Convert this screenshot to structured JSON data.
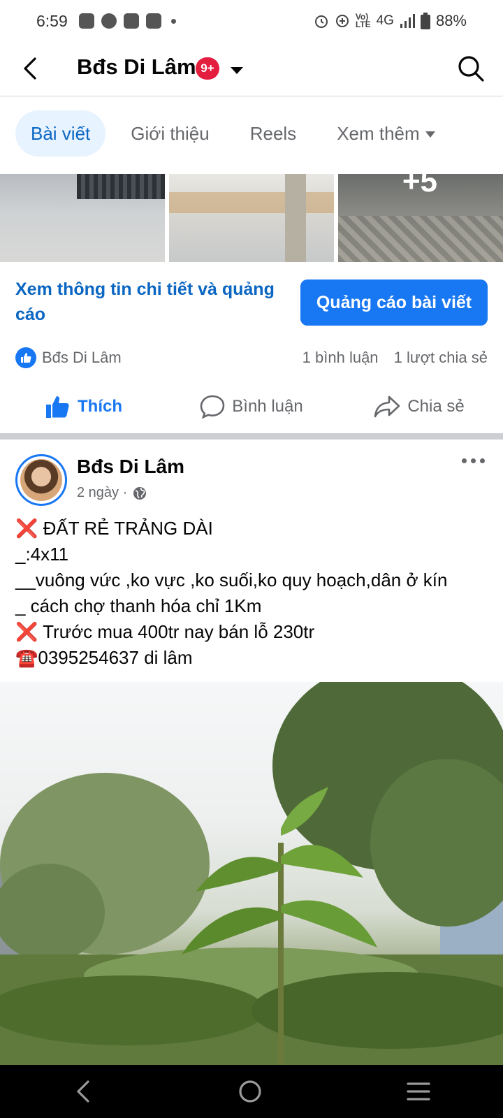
{
  "status": {
    "time": "6:59",
    "network": "4G",
    "battery": "88%"
  },
  "header": {
    "title": "Bđs Di Lâm",
    "badge": "9+"
  },
  "tabs": [
    {
      "label": "Bài viết",
      "active": true
    },
    {
      "label": "Giới thiệu",
      "active": false
    },
    {
      "label": "Reels",
      "active": false
    },
    {
      "label": "Xem thêm",
      "active": false
    }
  ],
  "photo_strip": {
    "more_count": "+5"
  },
  "ad": {
    "details_link": "Xem thông tin chi tiết và quảng cáo",
    "boost_button": "Quảng cáo bài viết"
  },
  "summary": {
    "reactor": "Bđs Di Lâm",
    "comments": "1 bình luận",
    "shares": "1 lượt chia sẻ"
  },
  "actions": {
    "like": "Thích",
    "comment": "Bình luận",
    "share": "Chia sẻ"
  },
  "post": {
    "author": "Bđs Di Lâm",
    "time": "2 ngày ·",
    "lines": [
      "❌ ĐẤT RẺ TRẢNG DÀI",
      "_:4x11",
      "__vuông vức ,ko vực ,ko suối,ko quy hoạch,dân ở kín",
      "_ cách chợ thanh hóa chỉ 1Km",
      "❌ Trước mua 400tr nay bán lỗ 230tr",
      "☎️0395254637 di lâm"
    ]
  },
  "colors": {
    "accent": "#1877f2",
    "link": "#0a66c2",
    "badge": "#e41e3f"
  }
}
